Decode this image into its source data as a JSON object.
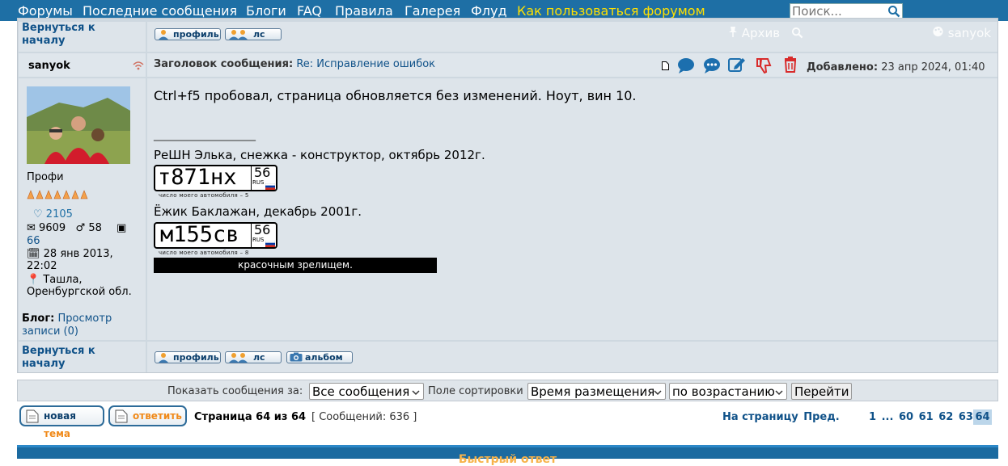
{
  "nav": {
    "items": [
      "Форумы",
      "Последние сообщения",
      "Блоги",
      "FAQ",
      "Правила",
      "Галерея",
      "Флуд"
    ],
    "howto": "Как пользоваться форумом",
    "search_placeholder": "Поиск..."
  },
  "top_row": {
    "back": "Вернуться к началу",
    "profile_btn": "профиль",
    "pm_btn": "лс",
    "archive": "Архив",
    "user_faded": "sanyok"
  },
  "post": {
    "author": "sanyok",
    "subject_label": "Заголовок сообщения:",
    "subject": "Re: Исправление ошибок",
    "added_label": "Добавлено:",
    "added_date": "23 апр 2024, 01:40",
    "body": "Ctrl+f5 пробовал, страница обновляется без изменений. Ноут, вин 10.",
    "sig_divider": "__________________",
    "sig_line1": "РеШН Элька, снежка - конструктор, октябрь 2012г.",
    "plate1_number": "т871нх",
    "plate1_region": "56",
    "plate1_caption": "число моего автомобиля – 5",
    "sig_line2": "Ёжик Баклажан, декабрь 2001г.",
    "plate2_number": "м155св",
    "plate2_region": "56",
    "plate2_caption": "число моего автомобиля – 8",
    "plate_rus": "RUS",
    "black_bar": "красочным зрелищем."
  },
  "profile": {
    "rank": "Профи",
    "likes": "2105",
    "messages": "9609",
    "gender_count": "58",
    "photos": "66",
    "reg_date": "28 янв 2013, 22:02",
    "location": "Ташла, Оренбургской обл.",
    "blog_label": "Блог:",
    "blog_link": "Просмотр записи (0)"
  },
  "bottom_row": {
    "back": "Вернуться к началу",
    "profile_btn": "профиль",
    "pm_btn": "лс",
    "album_btn": "альбом"
  },
  "sort": {
    "show_label": "Показать сообщения за:",
    "show_value": "Все сообщения",
    "sort_label": "Поле сортировки",
    "sort_value": "Время размещения",
    "order_value": "по возрастанию",
    "go": "Перейти"
  },
  "footer": {
    "new_topic_1": "новая",
    "new_topic_2": "тема",
    "reply": "ответить",
    "page_info": "Страница 64 из 64",
    "posts_info": "[ Сообщений: 636 ]",
    "goto_label": "На страницу",
    "prev": "Пред.",
    "pages": [
      "1",
      "...",
      "60",
      "61",
      "62",
      "63"
    ],
    "current_page": "64",
    "quick_reply": "Быстрый ответ"
  },
  "colors": {
    "nav_bg": "#1e6fa5",
    "nav_highlight": "#ffe000",
    "link": "#105289",
    "post_bg": "#dde4ea",
    "icon_blue": "#1c6fae",
    "icon_red": "#d82b2b"
  }
}
